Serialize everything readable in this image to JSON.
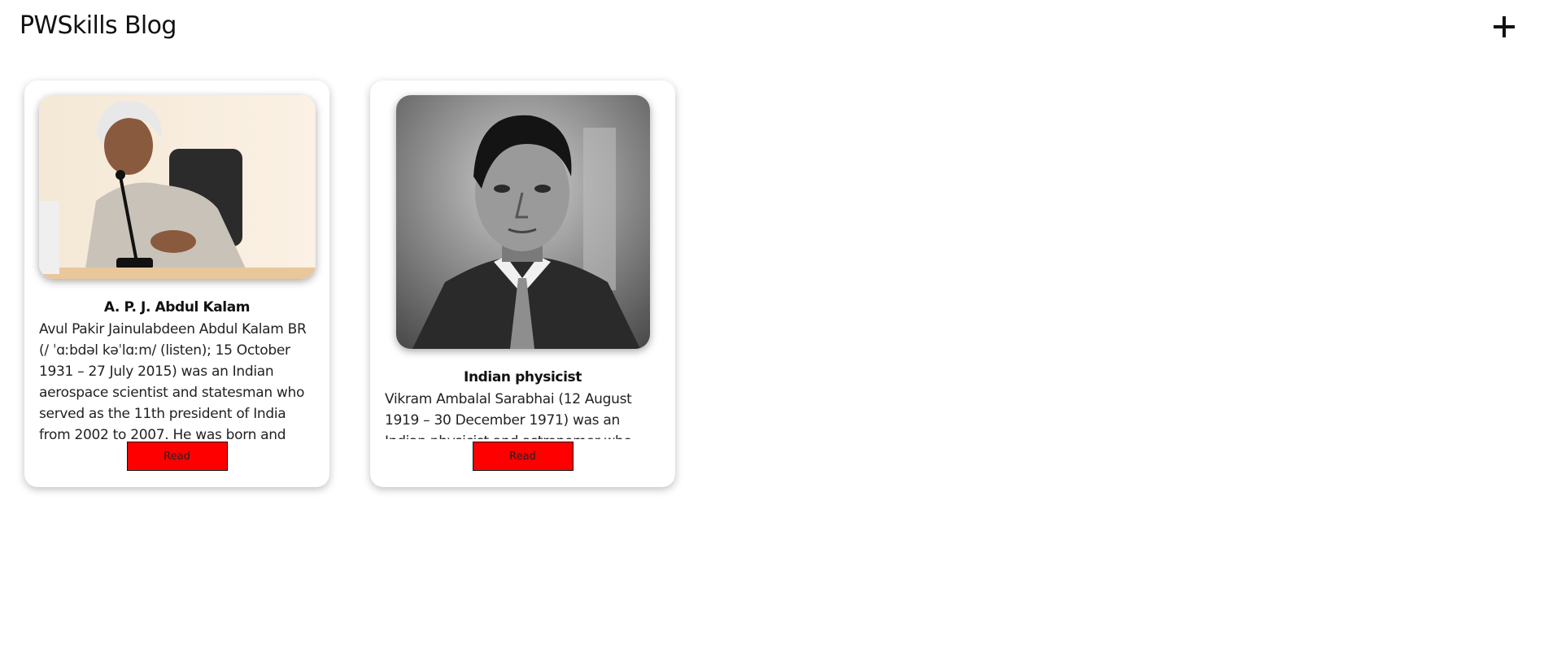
{
  "header": {
    "title": "PWSkills Blog",
    "add_icon": "plus-icon"
  },
  "cards": [
    {
      "title": "A. P. J. Abdul Kalam",
      "body": "Avul Pakir Jainulabdeen Abdul Kalam BR (/ ˈɑːbdəl kəˈlɑːm/ (listen); 15 October 1931 – 27 July 2015) was an Indian aerospace scientist and statesman who served as the 11th president of India from 2002 to 2007. He was born and raised in Rameswaram,",
      "button_label": "Read",
      "image": "portrait-photo"
    },
    {
      "title": "Indian physicist",
      "body": "Vikram Ambalal Sarabhai (12 August 1919 – 30 December 1971) was an Indian physicist and astronomer who initiated space",
      "button_label": "Read",
      "image": "portrait-photo"
    }
  ],
  "colors": {
    "read_button": "#ff0000",
    "background": "#ffffff"
  }
}
